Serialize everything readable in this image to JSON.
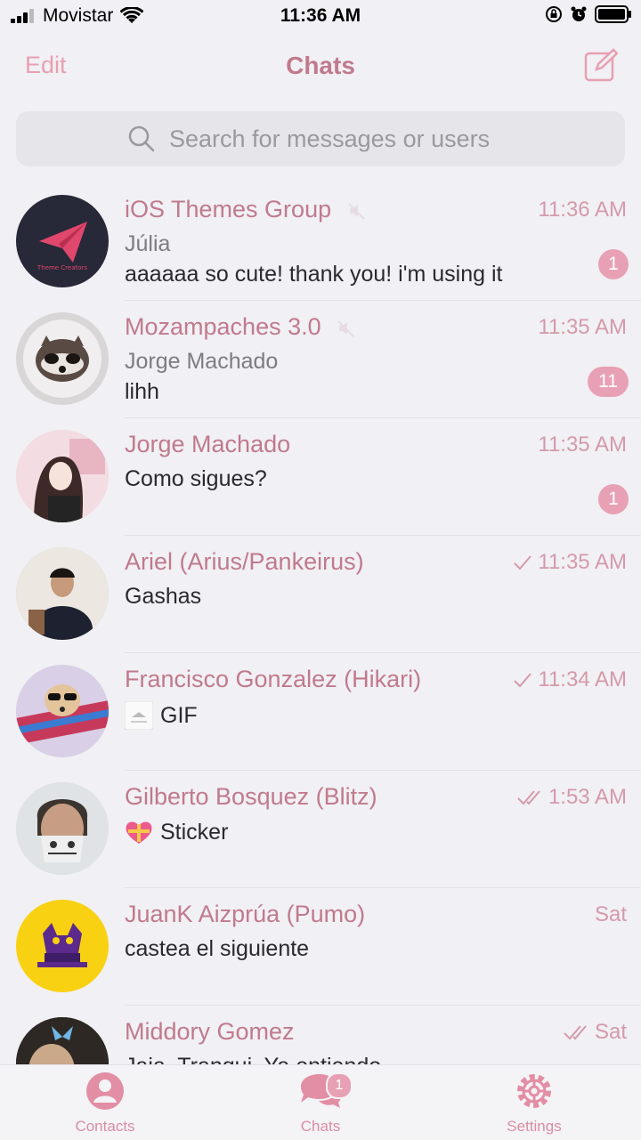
{
  "status_bar": {
    "carrier": "Movistar",
    "time": "11:36 AM"
  },
  "nav": {
    "edit_label": "Edit",
    "title": "Chats",
    "compose_icon": "compose-icon"
  },
  "search": {
    "placeholder": "Search for messages or users"
  },
  "colors": {
    "accent": "#c07a8d",
    "accent_light": "#e8a1b4",
    "background": "#f1f0f4"
  },
  "chats": [
    {
      "name": "iOS Themes Group",
      "muted": true,
      "time": "11:36 AM",
      "sender": "Júlia",
      "message": "aaaaaa so cute! thank you!  i'm using it",
      "badge": "1",
      "avatar_text": "Theme Creators"
    },
    {
      "name": "Mozampaches 3.0",
      "muted": true,
      "time": "11:35 AM",
      "sender": "Jorge Machado",
      "message": "lihh",
      "badge": "11"
    },
    {
      "name": "Jorge Machado",
      "time": "11:35 AM",
      "message": "Como sigues?",
      "badge": "1"
    },
    {
      "name": "Ariel (Arius/Pankeirus)",
      "time": "11:35 AM",
      "status": "sent",
      "message": "Gashas"
    },
    {
      "name": "Francisco Gonzalez (Hikari)",
      "time": "11:34 AM",
      "status": "sent",
      "message": "GIF"
    },
    {
      "name": "Gilberto Bosquez (Blitz)",
      "time": "1:53 AM",
      "status": "read",
      "message": "Sticker"
    },
    {
      "name": "JuanK Aizprúa (Pumo)",
      "time": "Sat",
      "message": "castea el siguiente"
    },
    {
      "name": "Middory Gomez",
      "time": "Sat",
      "status": "read",
      "message": "Jaja. Tranqui. Ya entiendo"
    }
  ],
  "tabs": [
    {
      "label": "Contacts",
      "icon": "person-icon"
    },
    {
      "label": "Chats",
      "icon": "chat-bubbles-icon",
      "badge": "1"
    },
    {
      "label": "Settings",
      "icon": "gear-icon"
    }
  ]
}
